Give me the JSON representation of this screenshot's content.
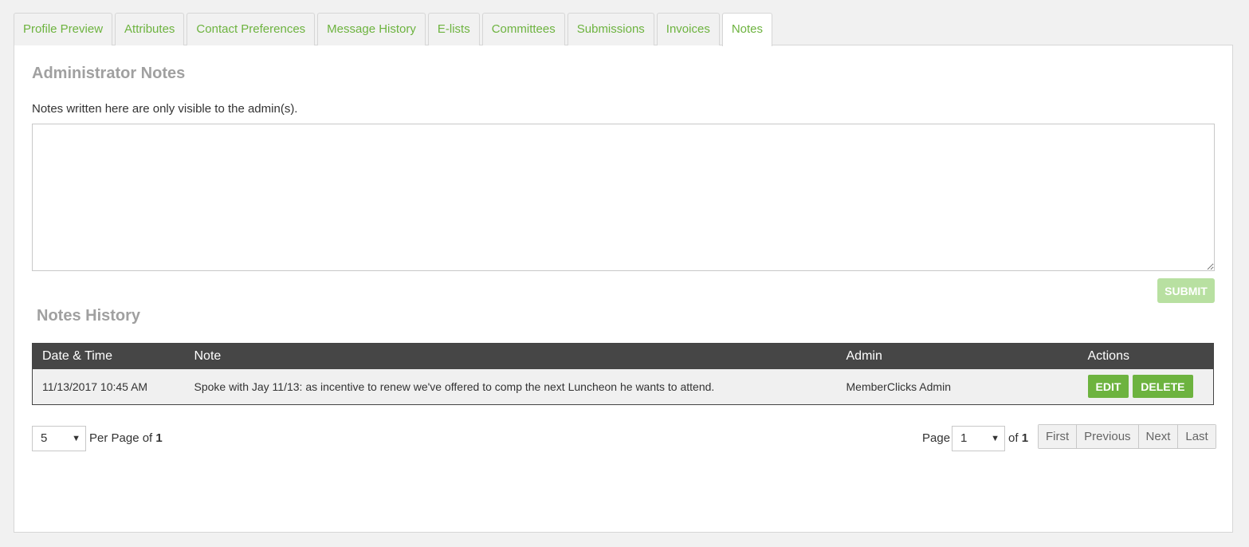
{
  "tabs": [
    {
      "label": "Profile Preview"
    },
    {
      "label": "Attributes"
    },
    {
      "label": "Contact Preferences"
    },
    {
      "label": "Message History"
    },
    {
      "label": "E-lists"
    },
    {
      "label": "Committees"
    },
    {
      "label": "Submissions"
    },
    {
      "label": "Invoices"
    },
    {
      "label": "Notes",
      "active": true
    }
  ],
  "admin_notes": {
    "title": "Administrator Notes",
    "description": "Notes written here are only visible to the admin(s).",
    "textarea_value": "",
    "submit_label": "SUBMIT"
  },
  "history": {
    "title": "Notes History",
    "columns": [
      "Date & Time",
      "Note",
      "Admin",
      "Actions"
    ],
    "rows": [
      {
        "datetime": "11/13/2017 10:45 AM",
        "note": "Spoke with Jay 11/13: as incentive to renew we've offered to comp the next Luncheon he wants to attend.",
        "admin": "MemberClicks Admin",
        "edit_label": "EDIT",
        "delete_label": "DELETE"
      }
    ]
  },
  "pagination": {
    "per_page_value": "5",
    "per_page_label": "Per Page of",
    "per_page_total": "1",
    "page_label": "Page",
    "page_value": "1",
    "of_label": "of",
    "page_total": "1",
    "first": "First",
    "previous": "Previous",
    "next": "Next",
    "last": "Last"
  },
  "colors": {
    "accent": "#6db33f",
    "submit_disabled": "#b8e0a1",
    "table_header": "#464646"
  }
}
